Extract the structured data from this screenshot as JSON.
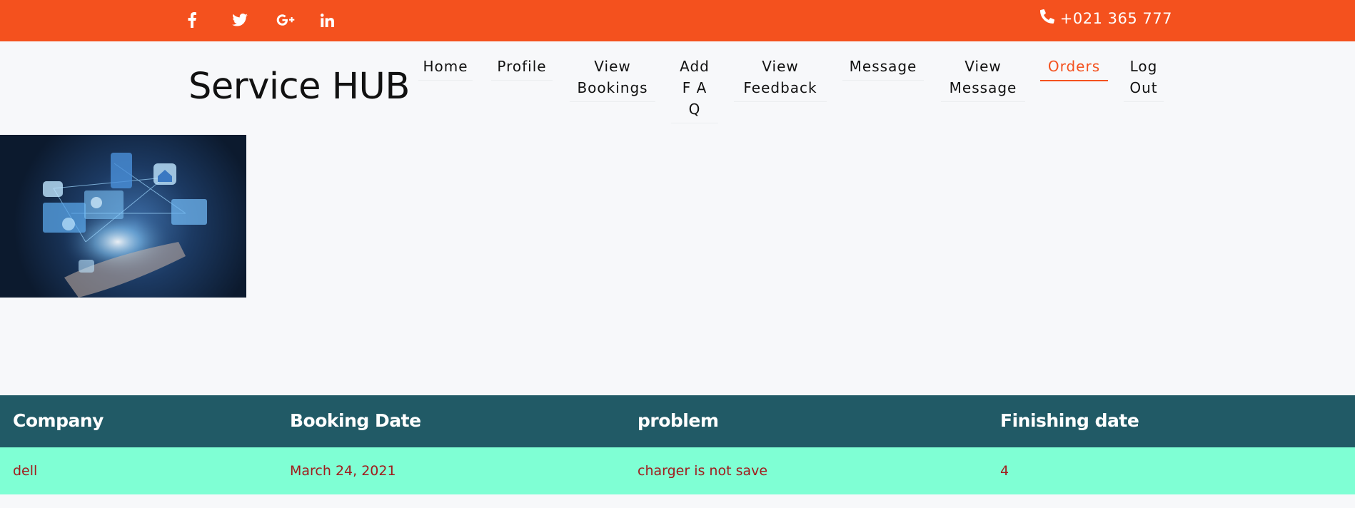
{
  "topbar": {
    "social": [
      {
        "name": "facebook-icon",
        "glyph": "f"
      },
      {
        "name": "twitter-icon",
        "glyph": ""
      },
      {
        "name": "google-plus-icon",
        "glyph": "G+"
      },
      {
        "name": "linkedin-icon",
        "glyph": "in"
      }
    ],
    "phone": "+021 365 777"
  },
  "brand": "Service HUB",
  "nav": {
    "home": "Home",
    "profile": "Profile",
    "view_bookings": "View\nBookings",
    "add_faq": "Add\nF A\nQ",
    "view_feedback": "View\nFeedback",
    "message": "Message",
    "view_message": "View\nMessage",
    "orders": "Orders",
    "logout": "Log\nOut"
  },
  "table": {
    "headers": [
      "Company",
      "Booking Date",
      "problem",
      "Finishing date"
    ],
    "rows": [
      [
        "dell",
        "March 24, 2021",
        "charger is not save",
        "4"
      ]
    ]
  },
  "colors": {
    "accent": "#f4511e",
    "table_header": "#215a66",
    "row_bg": "#7fffd4",
    "row_text": "#a11d1d"
  }
}
